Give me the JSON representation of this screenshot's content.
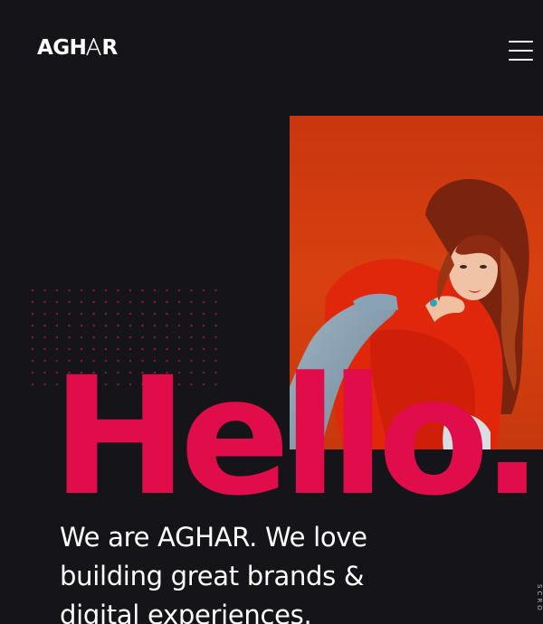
{
  "header": {
    "logo_text": "AGHAR",
    "logo_parts": [
      "AGH",
      "A",
      "R"
    ],
    "menu_icon": "hamburger-menu-icon"
  },
  "hero": {
    "image_subject": "woman-in-red-outfit-photo",
    "headline": "Hello.",
    "intro_line_1": "We are AGHAR. We love",
    "intro_line_2": "building great brands &",
    "intro_line_3": "digital experiences."
  },
  "scroll": {
    "label": "SCRO"
  },
  "colors": {
    "background": "#141419",
    "accent": "#e10d4a",
    "image_bg": "#d33c11",
    "text": "#ffffff"
  }
}
